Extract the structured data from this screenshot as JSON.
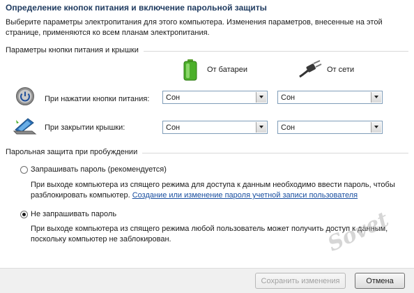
{
  "header": {
    "title": "Определение кнопок питания и включение парольной защиты",
    "description": "Выберите параметры электропитания для этого компьютера. Изменения параметров, внесенные на этой странице, применяются ко всем планам электропитания."
  },
  "power_buttons": {
    "group_label": "Параметры кнопки питания и крышки",
    "col_battery": "От батареи",
    "col_ac": "От сети",
    "rows": [
      {
        "label": "При нажатии кнопки питания:",
        "battery": "Сон",
        "ac": "Сон",
        "icon": "power-button-icon"
      },
      {
        "label": "При закрытии крышки:",
        "battery": "Сон",
        "ac": "Сон",
        "icon": "laptop-lid-icon"
      }
    ]
  },
  "password": {
    "group_label": "Парольная защита при пробуждении",
    "option1": {
      "label": "Запрашивать пароль (рекомендуется)",
      "selected": false,
      "note": "При выходе компьютера из спящего режима для доступа к данным необходимо ввести пароль, чтобы разблокировать компьютер.",
      "link": "Создание или изменение пароля учетной записи пользователя"
    },
    "option2": {
      "label": "Не запрашивать пароль",
      "selected": true,
      "note": "При выходе компьютера из спящего режима любой пользователь может получить доступ к данным, поскольку компьютер не заблокирован."
    }
  },
  "footer": {
    "save_label": "Сохранить изменения",
    "save_enabled": false,
    "cancel_label": "Отмена"
  },
  "watermark": "Sovet",
  "colors": {
    "title": "#1e3a5f",
    "link": "#1a4fa0",
    "battery": "#4caf2a"
  }
}
